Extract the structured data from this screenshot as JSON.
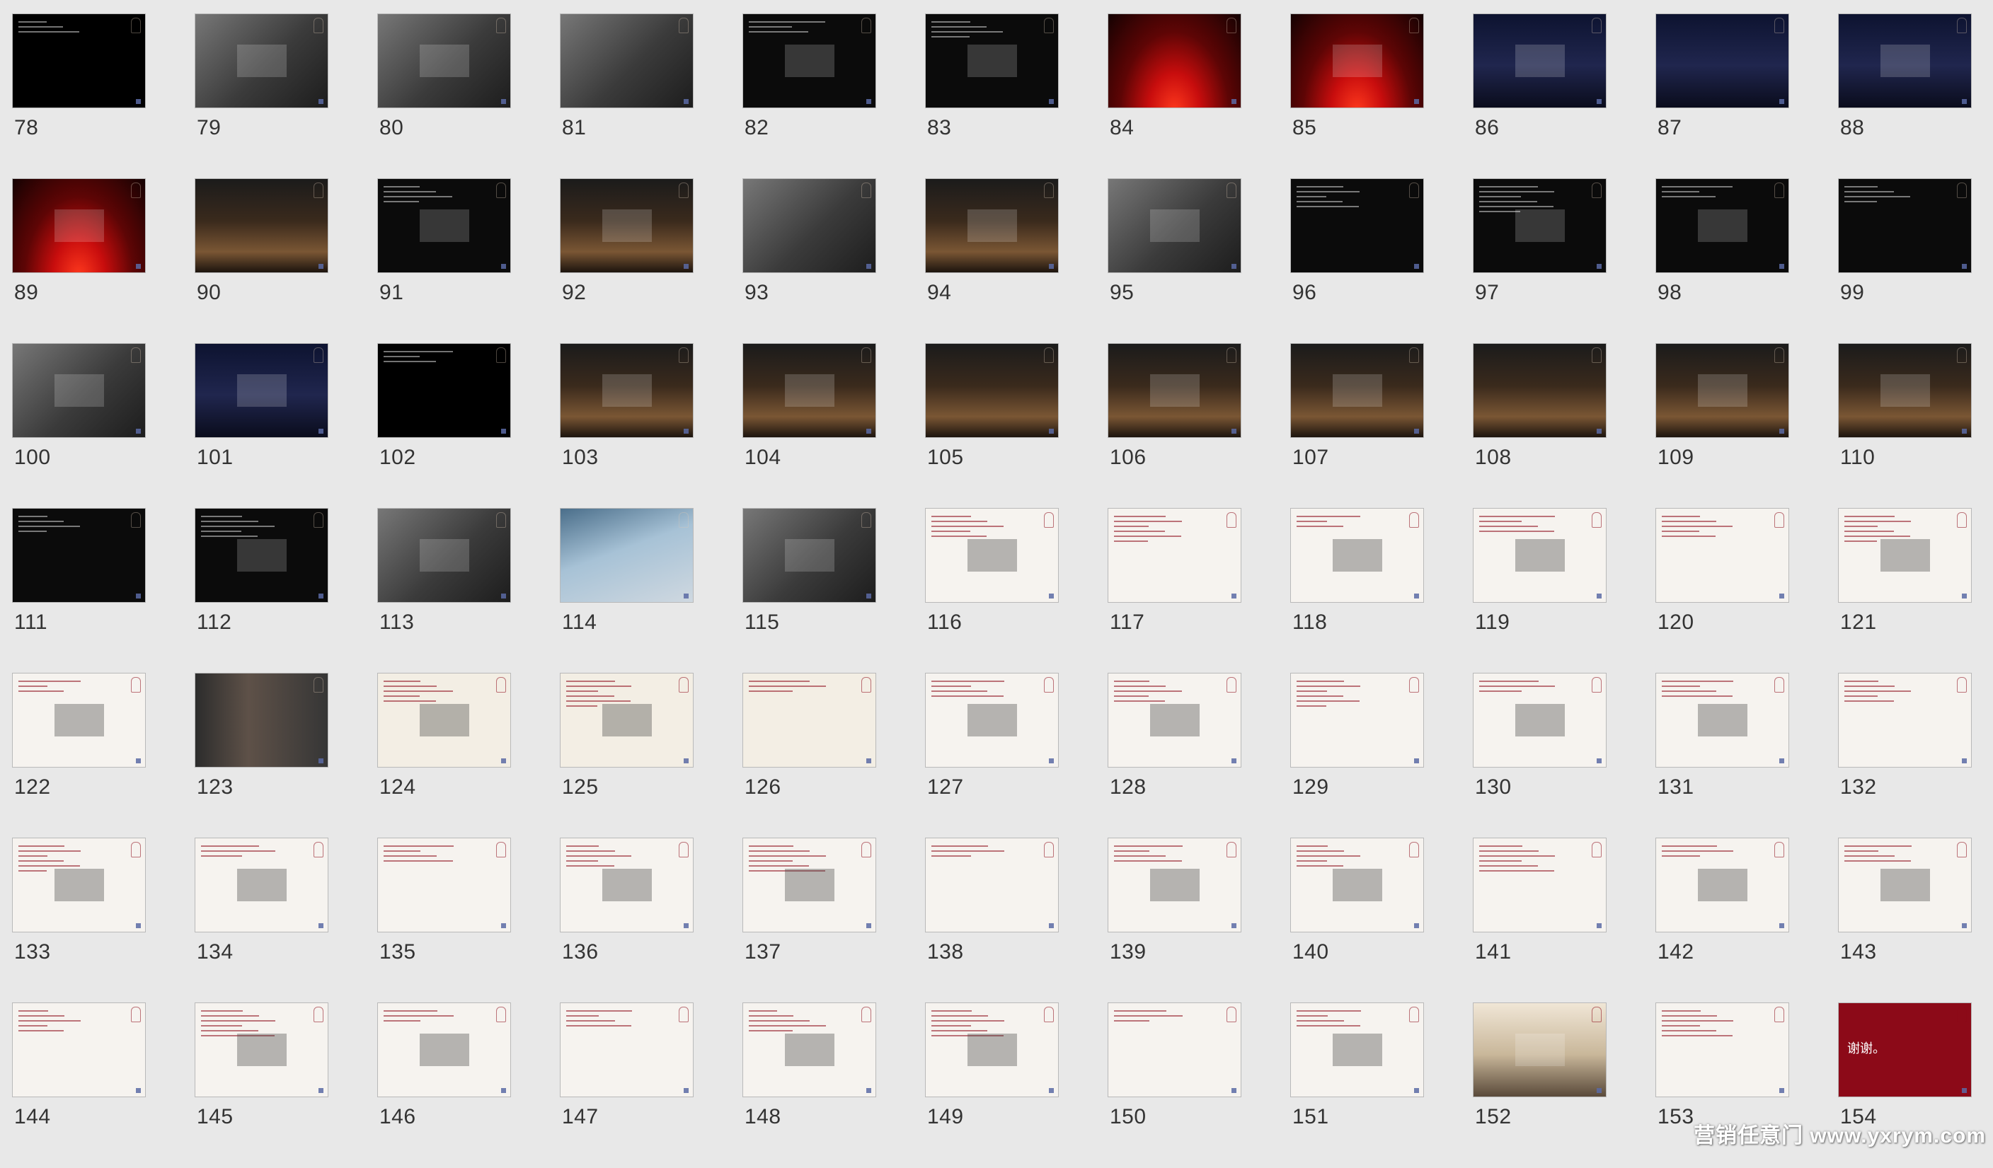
{
  "slides": [
    {
      "n": "78",
      "style": "map"
    },
    {
      "n": "79",
      "style": "photo"
    },
    {
      "n": "80",
      "style": "photo"
    },
    {
      "n": "81",
      "style": "photo"
    },
    {
      "n": "82",
      "style": "dark"
    },
    {
      "n": "83",
      "style": "dark"
    },
    {
      "n": "84",
      "style": "curtain"
    },
    {
      "n": "85",
      "style": "curtain"
    },
    {
      "n": "86",
      "style": "stageblue"
    },
    {
      "n": "87",
      "style": "stageblue"
    },
    {
      "n": "88",
      "style": "stageblue"
    },
    {
      "n": "89",
      "style": "curtain"
    },
    {
      "n": "90",
      "style": "stage"
    },
    {
      "n": "91",
      "style": "dark"
    },
    {
      "n": "92",
      "style": "stage"
    },
    {
      "n": "93",
      "style": "photo"
    },
    {
      "n": "94",
      "style": "stage"
    },
    {
      "n": "95",
      "style": "photo"
    },
    {
      "n": "96",
      "style": "dark"
    },
    {
      "n": "97",
      "style": "dark"
    },
    {
      "n": "98",
      "style": "dark"
    },
    {
      "n": "99",
      "style": "dark"
    },
    {
      "n": "100",
      "style": "photo"
    },
    {
      "n": "101",
      "style": "stageblue"
    },
    {
      "n": "102",
      "style": "map"
    },
    {
      "n": "103",
      "style": "stage"
    },
    {
      "n": "104",
      "style": "stage"
    },
    {
      "n": "105",
      "style": "stage"
    },
    {
      "n": "106",
      "style": "stage"
    },
    {
      "n": "107",
      "style": "stage"
    },
    {
      "n": "108",
      "style": "stage"
    },
    {
      "n": "109",
      "style": "stage"
    },
    {
      "n": "110",
      "style": "stage"
    },
    {
      "n": "111",
      "style": "dark"
    },
    {
      "n": "112",
      "style": "dark"
    },
    {
      "n": "113",
      "style": "photo"
    },
    {
      "n": "114",
      "style": "city"
    },
    {
      "n": "115",
      "style": "photo"
    },
    {
      "n": "116",
      "style": "light"
    },
    {
      "n": "117",
      "style": "light"
    },
    {
      "n": "118",
      "style": "light"
    },
    {
      "n": "119",
      "style": "light"
    },
    {
      "n": "120",
      "style": "light"
    },
    {
      "n": "121",
      "style": "light"
    },
    {
      "n": "122",
      "style": "light"
    },
    {
      "n": "123",
      "style": "people"
    },
    {
      "n": "124",
      "style": "sepia"
    },
    {
      "n": "125",
      "style": "sepia"
    },
    {
      "n": "126",
      "style": "sepia"
    },
    {
      "n": "127",
      "style": "light"
    },
    {
      "n": "128",
      "style": "light"
    },
    {
      "n": "129",
      "style": "light"
    },
    {
      "n": "130",
      "style": "light"
    },
    {
      "n": "131",
      "style": "light"
    },
    {
      "n": "132",
      "style": "light"
    },
    {
      "n": "133",
      "style": "light"
    },
    {
      "n": "134",
      "style": "light"
    },
    {
      "n": "135",
      "style": "light"
    },
    {
      "n": "136",
      "style": "light"
    },
    {
      "n": "137",
      "style": "light"
    },
    {
      "n": "138",
      "style": "light"
    },
    {
      "n": "139",
      "style": "light"
    },
    {
      "n": "140",
      "style": "light"
    },
    {
      "n": "141",
      "style": "light"
    },
    {
      "n": "142",
      "style": "light"
    },
    {
      "n": "143",
      "style": "light"
    },
    {
      "n": "144",
      "style": "light"
    },
    {
      "n": "145",
      "style": "light"
    },
    {
      "n": "146",
      "style": "light"
    },
    {
      "n": "147",
      "style": "light"
    },
    {
      "n": "148",
      "style": "light"
    },
    {
      "n": "149",
      "style": "light"
    },
    {
      "n": "150",
      "style": "light"
    },
    {
      "n": "151",
      "style": "light"
    },
    {
      "n": "152",
      "style": "mic"
    },
    {
      "n": "153",
      "style": "light"
    },
    {
      "n": "154",
      "style": "red",
      "text": "谢谢。"
    }
  ],
  "watermark": "营销任意门 www.yxrym.com",
  "colors": {
    "accent": "#8c0a18",
    "background": "#e8e8e8",
    "corner": "#5a6aa5"
  }
}
